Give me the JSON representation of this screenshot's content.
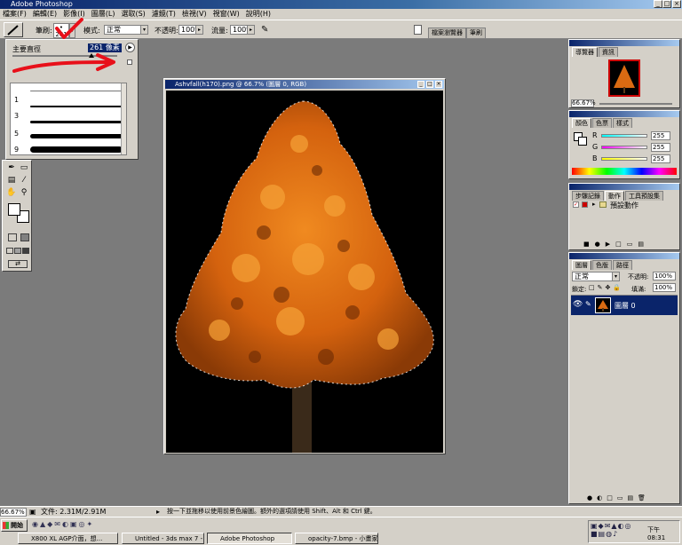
{
  "window": {
    "title": "Adobe Photoshop"
  },
  "menu": [
    "檔案(F)",
    "編輯(E)",
    "影像(I)",
    "圖層(L)",
    "選取(S)",
    "濾鏡(T)",
    "檢視(V)",
    "視窗(W)",
    "說明(H)"
  ],
  "options_bar": {
    "brush_label": "筆刷:",
    "brush_size": "261",
    "mode_label": "模式:",
    "mode_value": "正常",
    "opacity_label": "不透明:",
    "opacity_value": "100%",
    "flow_label": "流量:",
    "flow_value": "100%",
    "palette_well_tabs": [
      "檔案瀏覽器",
      "筆刷"
    ]
  },
  "brush_popup": {
    "master_diameter_label": "主要直徑",
    "master_diameter_value": "261 像素",
    "brush_numbers": [
      "1",
      "3",
      "5",
      "9"
    ],
    "slider_fraction": 0.75
  },
  "document": {
    "title": "Ashvfall(h170).png @ 66.7% (圖層 0, RGB)"
  },
  "navigator": {
    "tabs": [
      "導覽器",
      "資訊"
    ],
    "zoom": "66.67%"
  },
  "color_panel": {
    "tabs": [
      "顏色",
      "色票",
      "樣式"
    ],
    "channels": [
      {
        "label": "R",
        "value": "255"
      },
      {
        "label": "G",
        "value": "255"
      },
      {
        "label": "B",
        "value": "255"
      }
    ]
  },
  "history_panel": {
    "tabs": [
      "步驟記錄",
      "動作",
      "工具預設集"
    ],
    "item": "預設動作"
  },
  "layers_panel": {
    "tabs": [
      "圖層",
      "色版",
      "路徑"
    ],
    "blend_mode": "正常",
    "opacity_label": "不透明:",
    "opacity_value": "100%",
    "lock_label": "鎖定:",
    "fill_label": "填滿:",
    "fill_value": "100%",
    "layer_name": "圖層 0"
  },
  "status_bar": {
    "zoom": "66.67%",
    "doc_size": "文件: 2.31M/2.91M",
    "hint": "按一下並拖移以使用前景色繪圖。額外的選項請使用 Shift、Alt 和 Ctrl 鍵。"
  },
  "taskbar": {
    "start": "開始",
    "clock": "下午 08:31",
    "buttons": [
      "X800 XL AGP介面，想...",
      "Untitled - 3ds max 7 - Sta...",
      "Adobe Photoshop",
      "opacity-7.bmp - 小畫家"
    ]
  },
  "colors": {
    "title_dark": "#0a246a",
    "title_light": "#a6caf0",
    "chrome": "#d4d0c8",
    "workspace": "#7b7b7b",
    "annotation": "#e8101a",
    "tree": "#d96a12"
  }
}
